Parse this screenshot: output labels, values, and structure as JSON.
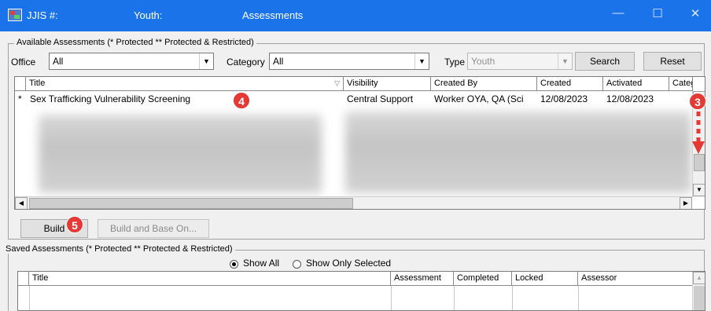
{
  "window": {
    "title_jjis": "JJIS #:",
    "title_youth": "Youth:",
    "title_assessments": "Assessments",
    "minimize": "—",
    "maximize": "☐",
    "close": "✕"
  },
  "available": {
    "legend": "Available Assessments  (* Protected  ** Protected & Restricted)",
    "office_label": "Office",
    "office_value": "All",
    "category_label": "Category",
    "category_value": "All",
    "type_label": "Type",
    "type_value": "Youth",
    "search_label": "Search",
    "reset_label": "Reset",
    "columns": [
      "Title",
      "Visibility",
      "Created By",
      "Created",
      "Activated",
      "Categ"
    ],
    "rows": [
      {
        "marker": "*",
        "title": "Sex Trafficking Vulnerability Screening",
        "visibility": "Central Support",
        "created_by": "Worker OYA, QA (Sci",
        "created": "12/08/2023",
        "activated": "12/08/2023"
      }
    ],
    "build_label": "Build",
    "build_base_label": "Build and Base On..."
  },
  "saved": {
    "legend": "Saved Assessments  (* Protected  ** Protected & Restricted)",
    "show_all_label": "Show All",
    "show_selected_label": "Show Only Selected",
    "show_mode": "Show All",
    "columns": [
      "Title",
      "Assessment",
      "Completed",
      "Locked",
      "Assessor"
    ]
  },
  "annotations": {
    "badge_3": "3",
    "badge_4": "4",
    "badge_5": "5"
  },
  "colors": {
    "titlebar": "#1a73e8",
    "badge": "#e53935"
  }
}
